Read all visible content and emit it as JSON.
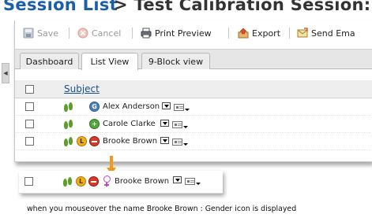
{
  "header": {
    "breadcrumb_link": "Session List",
    "breadcrumb_rest": "> Test Calibration Session:"
  },
  "toolbar": {
    "save_label": "Save",
    "cancel_label": "Cancel",
    "print_preview_label": "Print Preview",
    "export_label": "Export",
    "send_email_label": "Send Ema"
  },
  "tabs": {
    "dashboard": "Dashboard",
    "list_view": "List View",
    "nine_block_view": "9-Block view"
  },
  "grid": {
    "subject_header": "Subject",
    "rows": [
      {
        "name": "Alex Anderson",
        "badges": [
          "G"
        ]
      },
      {
        "name": "Carole Clarke",
        "badges": [
          "+"
        ]
      },
      {
        "name": "Brooke Brown",
        "badges": [
          "L",
          "-"
        ]
      }
    ]
  },
  "mouseover_row": {
    "name": "Brooke Brown",
    "badges": [
      "L",
      "-",
      "gender"
    ]
  },
  "caption": "when you mouseover the name Brooke Brown : Gender icon is displayed",
  "colors": {
    "title_link": "#1a5fa8",
    "title_text": "#333333",
    "arrow": "#f39a1e",
    "gender_icon": "#b84ec0",
    "progress_green": "#5aa028"
  }
}
